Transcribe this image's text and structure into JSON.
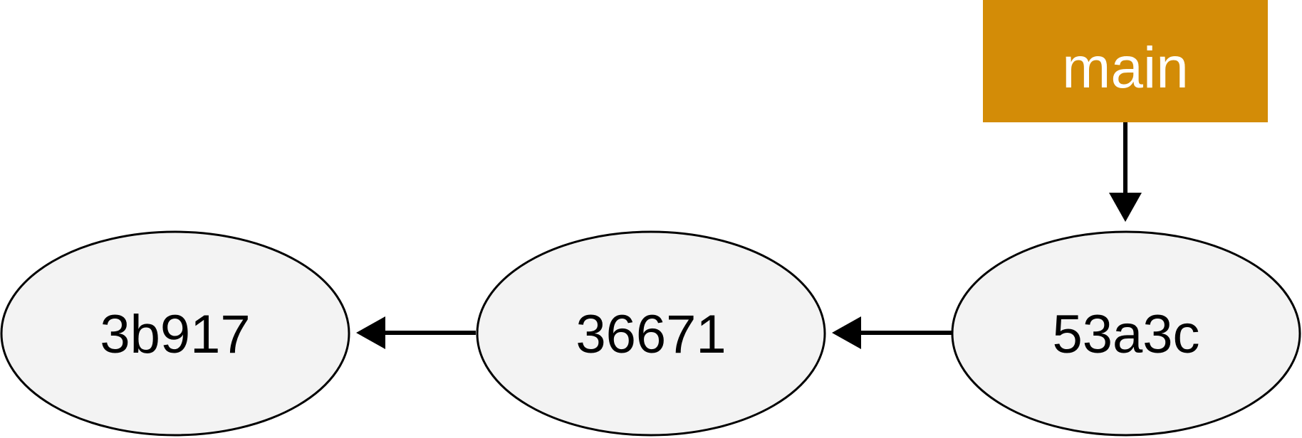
{
  "commits": [
    {
      "id": "3b917"
    },
    {
      "id": "36671"
    },
    {
      "id": "53a3c"
    }
  ],
  "branch": {
    "name": "main",
    "points_to": "53a3c"
  },
  "parent_links": [
    {
      "from": "53a3c",
      "to": "36671"
    },
    {
      "from": "36671",
      "to": "3b917"
    }
  ],
  "colors": {
    "commit_fill": "#f3f3f3",
    "branch_fill": "#d38c07",
    "branch_text": "#ffffff",
    "stroke": "#000000"
  }
}
